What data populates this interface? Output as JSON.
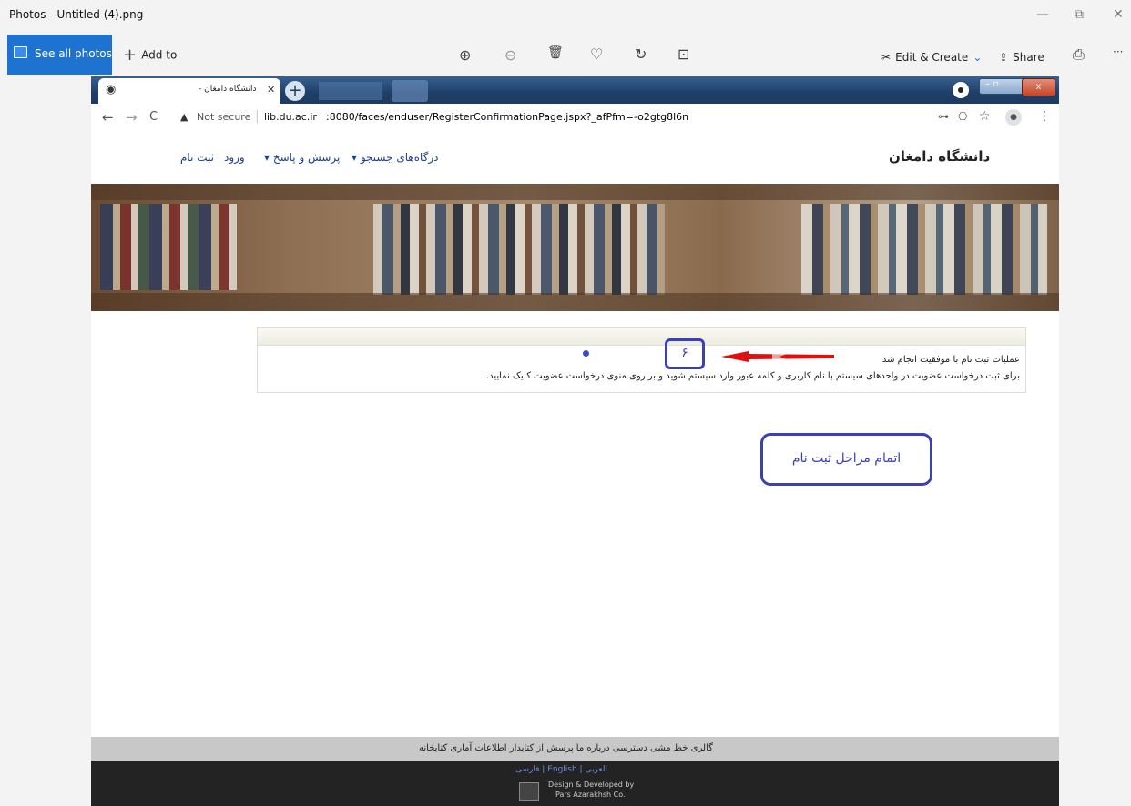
{
  "window": {
    "title": "Photos - Untitled (4).png",
    "minimize_glyph": "—",
    "maximize_glyph": "⧉",
    "close_glyph": "✕"
  },
  "toolbar": {
    "see_all_photos": "See all photos",
    "add_to": "Add to",
    "add_glyph": "+",
    "zoom_in_glyph": "⊕",
    "zoom_out_glyph": "⊖",
    "delete_glyph": "🗑",
    "favorite_glyph": "♡",
    "rotate_glyph": "↻",
    "crop_glyph": "⊡",
    "edit_create": "Edit & Create",
    "edit_glyph": "✂",
    "chevron_glyph": "⌄",
    "share": "Share",
    "share_glyph": "⇪",
    "print_glyph": "⎙",
    "more_glyph": "···"
  },
  "browser": {
    "tab_title": "دانشگاه دامغان -",
    "tab_close": "✕",
    "new_tab": "+",
    "back": "←",
    "forward": "→",
    "reload": "C",
    "security_warning": "▲",
    "not_secure": "Not secure",
    "url_host": "lib.du.ac.ir",
    "url_rest": ":8080/faces/enduser/RegisterConfirmationPage.jspx?_afPfm=-o2gtg8l6n",
    "key_glyph": "⊶",
    "translate_glyph": "⎔",
    "star_glyph": "☆",
    "profile_glyph": "●",
    "menu_glyph": "⋮",
    "window_close": "x",
    "window_minmax": "–  ▫"
  },
  "site": {
    "name": "دانشگاه دامغان",
    "nav": [
      {
        "label": "درگاه‌های جستجو ▾"
      },
      {
        "label": "پرسش و پاسخ ▾"
      },
      {
        "label": "ورود"
      },
      {
        "label": "ثبت نام"
      }
    ],
    "message_line1": "عملیات ثبت نام با موفقیت انجام شد",
    "message_line2": "برای ثبت درخواست عضویت در واحدهای سیستم با نام کاربری و کلمه عبور وارد سیستم شوید و بر روی منوی درخواست عضویت کلیک نمایید."
  },
  "annotations": {
    "step_number": "۶",
    "step_caption": "اتمام مراحل ثبت نام",
    "accent": "#3b3fb8",
    "arrow_color": "#e01010"
  },
  "footer": {
    "links": "گالری   خط مشی دسترسی   درباره ما   پرسش از کتابدار   اطلاعات آماری کتابخانه",
    "languages": "فارسی | English | العربی",
    "credit_line1": "Design & Developed by",
    "credit_line2": "Pars Azarakhsh Co."
  }
}
